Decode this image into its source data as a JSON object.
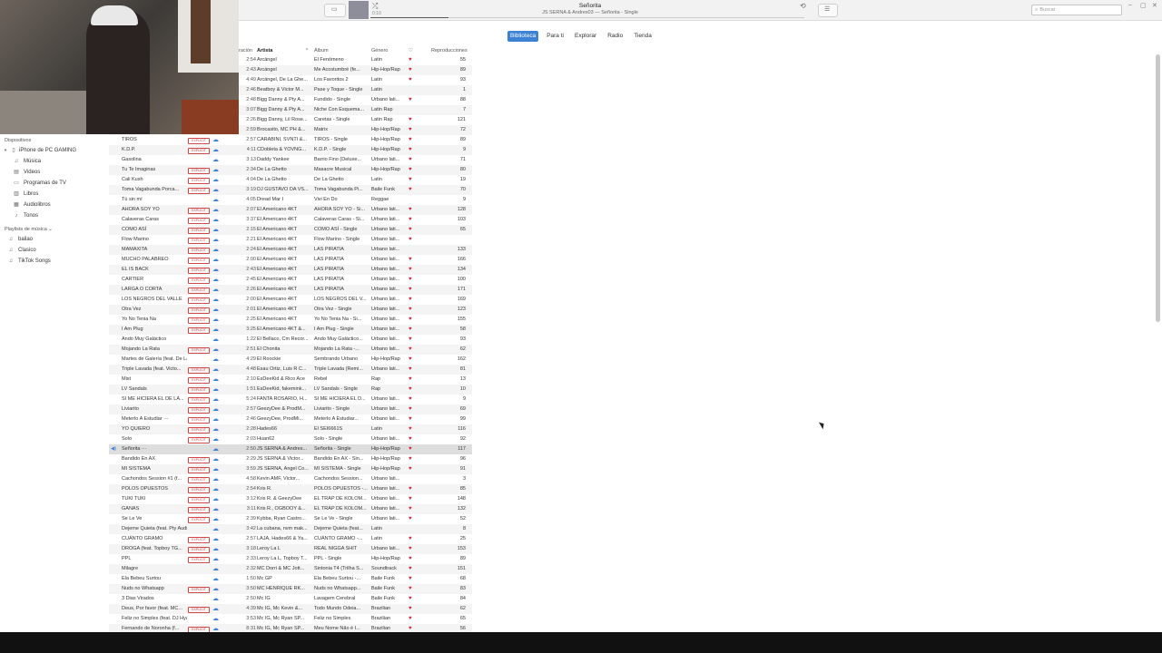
{
  "now_playing": {
    "title": "Señorita",
    "subtitle": "JS SERNA & Andres03 — Señorita - Single",
    "elapsed": "0:10",
    "progress": 0.18
  },
  "search": {
    "placeholder": "Buscar"
  },
  "tabs": [
    {
      "label": "Biblioteca",
      "active": true
    },
    {
      "label": "Para ti"
    },
    {
      "label": "Explorar"
    },
    {
      "label": "Radio"
    },
    {
      "label": "Tienda"
    }
  ],
  "sidebar": {
    "devices_header": "Dispositivos",
    "device": "iPhone de PC GAMING",
    "device_items": [
      {
        "label": "Música",
        "icon": "music-note-icon"
      },
      {
        "label": "Videos",
        "icon": "film-icon"
      },
      {
        "label": "Programas de TV",
        "icon": "tv-icon"
      },
      {
        "label": "Libros",
        "icon": "book-icon"
      },
      {
        "label": "Audiolibros",
        "icon": "audiobook-icon"
      },
      {
        "label": "Tonos",
        "icon": "bell-icon"
      }
    ],
    "playlists_header": "Playlists de música ⌄",
    "playlists": [
      "bailao",
      "Clasico",
      "TikTok Songs"
    ]
  },
  "columns": {
    "time": "ración",
    "artist": "Artista",
    "album": "Álbum",
    "genre": "Género",
    "plays": "Reproducciones"
  },
  "explicit_label": "EXPLICIT",
  "colors": {
    "accent": "#3b82d6",
    "heart": "#d8243a",
    "explicit": "#d04848"
  },
  "rows": [
    {
      "name": "",
      "time": "2:54",
      "artist": "Arcángel",
      "album": "El Fenómeno",
      "genre": "Latin",
      "heart": true,
      "plays": "55"
    },
    {
      "name": "",
      "time": "2:43",
      "artist": "Arcángel",
      "album": "Me Acostumbré (fe...",
      "genre": "Hip-Hop/Rap",
      "heart": true,
      "plays": "89"
    },
    {
      "name": "",
      "time": "4:49",
      "artist": "Arcángel, De La Ghe...",
      "album": "Los Favoritos 2",
      "genre": "Latin",
      "heart": true,
      "plays": "93"
    },
    {
      "name": "",
      "time": "2:46",
      "artist": "Beatboy & Victor M...",
      "album": "Pase y Toque - Single",
      "genre": "Latin",
      "heart": false,
      "plays": "1"
    },
    {
      "name": "",
      "time": "2:48",
      "artist": "Bigg Danny & Pty A...",
      "album": "Fundido - Single",
      "genre": "Urbano lati...",
      "heart": true,
      "plays": "88"
    },
    {
      "name": "",
      "time": "3:07",
      "artist": "Bigg Danny & Pty A...",
      "album": "Niche Con Esquema...",
      "genre": "Latin Rap",
      "heart": false,
      "plays": "7"
    },
    {
      "name": "",
      "time": "2:26",
      "artist": "Bigg Danny, Lil Rose...",
      "album": "Caretas - Single",
      "genre": "Latin Rap",
      "heart": true,
      "plays": "121"
    },
    {
      "name": "",
      "time": "2:59",
      "artist": "Brocasito, MC PH &...",
      "album": "Matrix",
      "genre": "Hip-Hop/Rap",
      "heart": true,
      "plays": "72"
    },
    {
      "name": "TIROS",
      "explicit": true,
      "time": "2:57",
      "artist": "CARABINI, SVNTI &...",
      "album": "TIROS - Single",
      "genre": "Hip-Hop/Rap",
      "heart": true,
      "plays": "89"
    },
    {
      "name": "K.D.P.",
      "explicit": true,
      "time": "4:11",
      "artist": "CDobleta & YOVNG...",
      "album": "K.D.P. - Single",
      "genre": "Hip-Hop/Rap",
      "heart": true,
      "plays": "9"
    },
    {
      "name": "Gasolina",
      "time": "3:13",
      "artist": "Daddy Yankee",
      "album": "Barrio Fino (Deluxe...",
      "genre": "Urbano lati...",
      "heart": true,
      "plays": "71"
    },
    {
      "name": "Tu Te Imaginas",
      "explicit": true,
      "time": "2:34",
      "artist": "De La Ghetto",
      "album": "Masacre Musical",
      "genre": "Hip-Hop/Rap",
      "heart": true,
      "plays": "80"
    },
    {
      "name": "Cali Kush",
      "explicit": true,
      "time": "4:04",
      "artist": "De La Ghetto",
      "album": "De La Ghetto",
      "genre": "Latin",
      "heart": true,
      "plays": "19"
    },
    {
      "name": "Toma Vagabunda Porca...",
      "explicit": true,
      "time": "3:19",
      "artist": "DJ GUSTAVO DA VS...",
      "album": "Toma Vagabunda Pi...",
      "genre": "Baile Funk",
      "heart": true,
      "plays": "70"
    },
    {
      "name": "Tú sin mí",
      "time": "4:05",
      "artist": "Dread Mar I",
      "album": "Vivi En Do",
      "genre": "Reggae",
      "heart": false,
      "plays": "9"
    },
    {
      "name": "AHORA SOY YO",
      "explicit": true,
      "time": "2:07",
      "artist": "El Americano 4KT",
      "album": "AHORA SOY YO - Si...",
      "genre": "Urbano lati...",
      "heart": true,
      "plays": "128"
    },
    {
      "name": "Calaveras Caras",
      "explicit": true,
      "time": "3:37",
      "artist": "El Americano 4KT",
      "album": "Calaveras Caras - Si...",
      "genre": "Urbano lati...",
      "heart": true,
      "plays": "103"
    },
    {
      "name": "COMO ASÍ",
      "explicit": true,
      "time": "2:15",
      "artist": "El Americano 4KT",
      "album": "COMO ASÍ - Single",
      "genre": "Urbano lati...",
      "heart": true,
      "plays": "65"
    },
    {
      "name": "Flow Marino",
      "explicit": true,
      "time": "2:21",
      "artist": "El Americano 4KT",
      "album": "Flow Marino - Single",
      "genre": "Urbano lati...",
      "heart": true,
      "plays": ""
    },
    {
      "name": "MAMAXITA",
      "explicit": true,
      "time": "2:24",
      "artist": "El Americano 4KT",
      "album": "LAS PIRATIA",
      "genre": "Urbano lati...",
      "heart": false,
      "plays": "133"
    },
    {
      "name": "MUCHO PALABREO",
      "explicit": true,
      "time": "2:00",
      "artist": "El Americano 4KT",
      "album": "LAS PIRATIA",
      "genre": "Urbano lati...",
      "heart": true,
      "plays": "166"
    },
    {
      "name": "EL IS BACK",
      "explicit": true,
      "time": "2:43",
      "artist": "El Americano 4KT",
      "album": "LAS PIRATIA",
      "genre": "Urbano lati...",
      "heart": true,
      "plays": "134"
    },
    {
      "name": "CARTIER",
      "explicit": true,
      "time": "2:45",
      "artist": "El Americano 4KT",
      "album": "LAS PIRATIA",
      "genre": "Urbano lati...",
      "heart": true,
      "plays": "100"
    },
    {
      "name": "LARGA O CORTA",
      "explicit": true,
      "time": "2:26",
      "artist": "El Americano 4KT",
      "album": "LAS PIRATIA",
      "genre": "Urbano lati...",
      "heart": true,
      "plays": "171"
    },
    {
      "name": "LOS NEGROS DEL VALLE",
      "explicit": true,
      "time": "2:00",
      "artist": "El Americano 4KT",
      "album": "LOS NEGROS DEL V...",
      "genre": "Urbano lati...",
      "heart": true,
      "plays": "169"
    },
    {
      "name": "Otra Vez",
      "explicit": true,
      "time": "2:01",
      "artist": "El Americano 4KT",
      "album": "Otra Vez - Single",
      "genre": "Urbano lati...",
      "heart": true,
      "plays": "123"
    },
    {
      "name": "Yo No Tenia Na",
      "explicit": true,
      "time": "2:25",
      "artist": "El Americano 4KT",
      "album": "Yo No Tenia Na - Si...",
      "genre": "Urbano lati...",
      "heart": true,
      "plays": "155"
    },
    {
      "name": "I Am Plug",
      "explicit": true,
      "time": "3:25",
      "artist": "El Americano 4KT &...",
      "album": "I Am Plug - Single",
      "genre": "Urbano lati...",
      "heart": true,
      "plays": "58"
    },
    {
      "name": "Ando Muy Galáctico",
      "time": "1:22",
      "artist": "El Bellaco, Cm Recor...",
      "album": "Ando Muy Galáctico...",
      "genre": "Urbano lati...",
      "heart": true,
      "plays": "93"
    },
    {
      "name": "Mojando La Rata",
      "explicit": true,
      "time": "2:51",
      "artist": "El Chonita",
      "album": "Mojando La Rata -...",
      "genre": "Urbano lati...",
      "heart": true,
      "plays": "62"
    },
    {
      "name": "Martes de Galería (feat. De La Ghe...",
      "time": "4:29",
      "artist": "El Roockie",
      "album": "Sembrando Urbano",
      "genre": "Hip-Hop/Rap",
      "heart": true,
      "plays": "162"
    },
    {
      "name": "Triple Lavada (feat. Victo...",
      "explicit": true,
      "time": "4:48",
      "artist": "Esau Ortiz, Luis R C...",
      "album": "Triple Lavada (Remi...",
      "genre": "Urbano lati...",
      "heart": true,
      "plays": "81"
    },
    {
      "name": "Mist",
      "explicit": true,
      "time": "2:10",
      "artist": "EsDeeKid & Rico Ace",
      "album": "Rebel",
      "genre": "Rap",
      "heart": true,
      "plays": "13"
    },
    {
      "name": "LV Sandals",
      "explicit": true,
      "time": "1:51",
      "artist": "EsDeeKid, fakemink...",
      "album": "LV Sandals - Single",
      "genre": "Rap",
      "heart": true,
      "plays": "10"
    },
    {
      "name": "SI ME HICIERA EL DE LA...",
      "explicit": true,
      "time": "5:24",
      "artist": "FANTA ROSARIO, H...",
      "album": "SI ME HICIERA EL D...",
      "genre": "Urbano lati...",
      "heart": true,
      "plays": "9"
    },
    {
      "name": "Liviarito",
      "explicit": true,
      "time": "2:57",
      "artist": "GeezyDee & ProdM...",
      "album": "Liviarito - Single",
      "genre": "Urbano lati...",
      "heart": true,
      "plays": "69"
    },
    {
      "name": "Meterlo A Estudiar ···",
      "explicit": true,
      "time": "2:46",
      "artist": "GeezyDee, ProdMi...",
      "album": "Meterlo A Estudiar...",
      "genre": "Urbano lati...",
      "heart": true,
      "plays": "99"
    },
    {
      "name": "YO QUIERO",
      "explicit": true,
      "time": "2:28",
      "artist": "Hades66",
      "album": "El SEI6661S",
      "genre": "Latin",
      "heart": true,
      "plays": "116"
    },
    {
      "name": "Solo",
      "explicit": true,
      "time": "2:03",
      "artist": "Huan62",
      "album": "Solo - Single",
      "genre": "Urbano lati...",
      "heart": true,
      "plays": "92"
    },
    {
      "name": "Señorita ···",
      "playing": true,
      "time": "2:50",
      "artist": "JS SERNA & Andres...",
      "album": "Señorita - Single",
      "genre": "Hip-Hop/Rap",
      "heart": true,
      "plays": "117"
    },
    {
      "name": "Bandido En AX",
      "explicit": true,
      "time": "2:29",
      "artist": "JS SERNA & Victor...",
      "album": "Bandido En AX - Sin...",
      "genre": "Hip-Hop/Rap",
      "heart": true,
      "plays": "96"
    },
    {
      "name": "MI SISTEMA",
      "explicit": true,
      "time": "3:59",
      "artist": "JS SERNA, Angel Co...",
      "album": "MI SISTEMA - Single",
      "genre": "Hip-Hop/Rap",
      "heart": true,
      "plays": "91"
    },
    {
      "name": "Cachondos Session #1 (f...",
      "explicit": true,
      "time": "4:58",
      "artist": "Kevin AMF, Victor...",
      "album": "Cachondos Session...",
      "genre": "Urbano lati...",
      "heart": false,
      "plays": "3"
    },
    {
      "name": "POLOS OPUESTOS",
      "explicit": true,
      "time": "2:54",
      "artist": "Kris R.",
      "album": "POLOS OPUESTOS -...",
      "genre": "Urbano lati...",
      "heart": true,
      "plays": "85"
    },
    {
      "name": "TUKI TUKI",
      "explicit": true,
      "time": "3:12",
      "artist": "Kris R. & GeezyDee",
      "album": "EL TRAP DE KOLOM...",
      "genre": "Urbano lati...",
      "heart": true,
      "plays": "148"
    },
    {
      "name": "GANAS",
      "explicit": true,
      "time": "3:11",
      "artist": "Kris R., OGBOOY &...",
      "album": "EL TRAP DE KOLOM...",
      "genre": "Urbano lati...",
      "heart": true,
      "plays": "132"
    },
    {
      "name": "Se Le Ve",
      "explicit": true,
      "time": "2:39",
      "artist": "Kybba, Ryan Castro...",
      "album": "Se Le Ve - Single",
      "genre": "Urbano lati...",
      "heart": true,
      "plays": "52"
    },
    {
      "name": "Dejeme Quieta (feat. Pty Audio)",
      "time": "3:42",
      "artist": "La cubana, nvm mak...",
      "album": "Dejeme Quieta (feat...",
      "genre": "Latin",
      "heart": false,
      "plays": "8"
    },
    {
      "name": "CUÁNTO GRAMO",
      "explicit": true,
      "time": "2:57",
      "artist": "LAJA, Hades66 & Ya...",
      "album": "CUÁNTO GRAMO -...",
      "genre": "Latin",
      "heart": true,
      "plays": "25"
    },
    {
      "name": "DROGA (feat. Topboy TG...",
      "explicit": true,
      "time": "3:18",
      "artist": "Leroy La L",
      "album": "REAL NIGGA SHIT",
      "genre": "Urbano lati...",
      "heart": true,
      "plays": "153"
    },
    {
      "name": "PPL",
      "explicit": true,
      "time": "2:33",
      "artist": "Leroy La L, Topboy T...",
      "album": "PPL - Single",
      "genre": "Hip-Hop/Rap",
      "heart": true,
      "plays": "89"
    },
    {
      "name": "Milagre",
      "time": "2:32",
      "artist": "MC Dorri & MC Jott...",
      "album": "Sintonia T4 (Trilha S...",
      "genre": "Soundtrack",
      "heart": true,
      "plays": "151"
    },
    {
      "name": "Ela Bebeu Surtou",
      "time": "1:50",
      "artist": "Mc GP",
      "album": "Ela Bebeu Surtou -...",
      "genre": "Baile Funk",
      "heart": true,
      "plays": "68"
    },
    {
      "name": "Nuds no Whatsapp",
      "explicit": true,
      "time": "3:50",
      "artist": "MC HENRIQUE RK...",
      "album": "Nuds no Whatsapp...",
      "genre": "Baile Funk",
      "heart": true,
      "plays": "83"
    },
    {
      "name": "3 Dias Virados",
      "time": "2:50",
      "artist": "Mc IG",
      "album": "Lavagem Cerebral",
      "genre": "Baile Funk",
      "heart": true,
      "plays": "84"
    },
    {
      "name": "Deus, Por favor (feat. MC...",
      "explicit": true,
      "time": "4:39",
      "artist": "Mc IG, Mc Kevin &...",
      "album": "Todo Mundo Odeia...",
      "genre": "Brazilian",
      "heart": true,
      "plays": "62"
    },
    {
      "name": "Feliz no Simples (feat. DJ Hyago)...",
      "time": "3:53",
      "artist": "Mc IG, Mc Ryan SP...",
      "album": "Feliz no Simples",
      "genre": "Brazilian",
      "heart": true,
      "plays": "65"
    },
    {
      "name": "Fernando de Noronha (f...",
      "explicit": true,
      "time": "8:31",
      "artist": "Mc IG, Mc Ryan SP...",
      "album": "Meu Nome Não é I...",
      "genre": "Brazilian",
      "heart": true,
      "plays": "56"
    }
  ]
}
